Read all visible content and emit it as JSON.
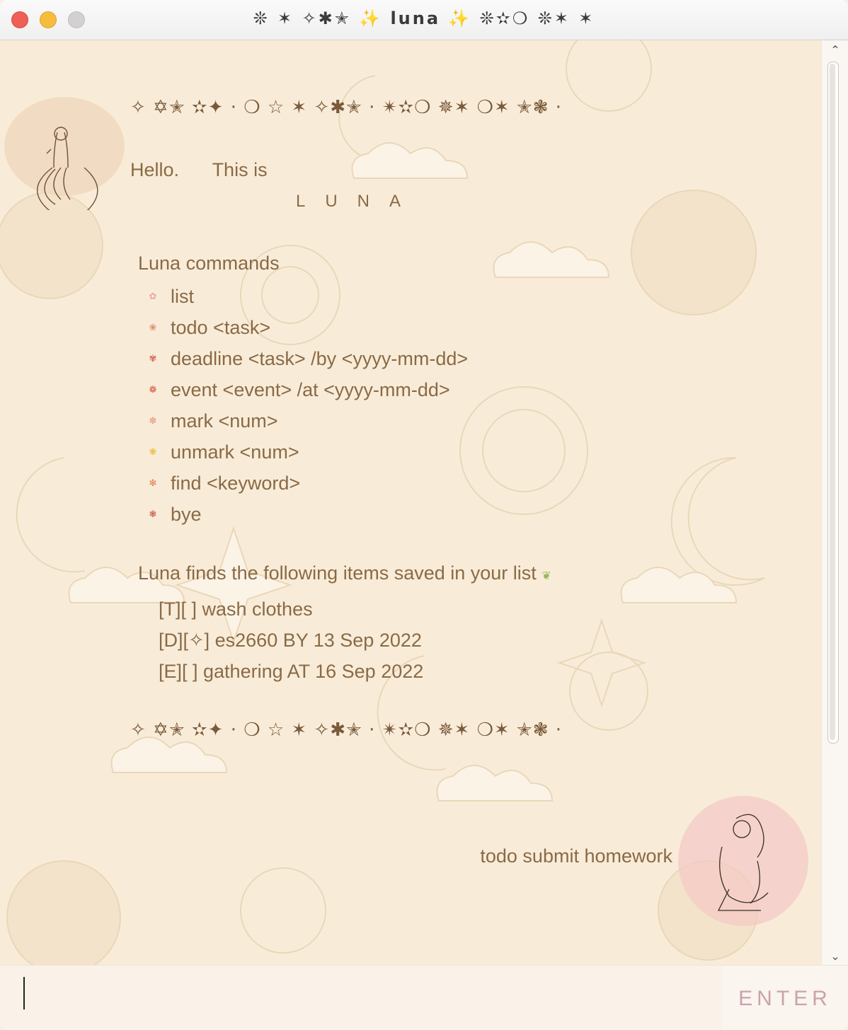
{
  "window": {
    "title": "❊ ✶ ✧✱✭ ✨ luna ✨ ❊✫❍ ❊✶ ✶"
  },
  "chat": {
    "divider_top": "✧ ✡✭ ✫✦ · ❍ ☆ ✶ ✧✱✭ ·  ✴✫❍ ✵✶ ❍✶ ✭❃ ·",
    "hello_a": "Hello.",
    "hello_b": "This is",
    "luna": "LUNA",
    "commands_title": "Luna commands",
    "commands": [
      {
        "label": "list",
        "bullet_color": "#e9a6a6"
      },
      {
        "label": "todo <task>",
        "bullet_color": "#e48a6a"
      },
      {
        "label": "deadline <task> /by <yyyy-mm-dd>",
        "bullet_color": "#d9625a"
      },
      {
        "label": "event <event> /at <yyyy-mm-dd>",
        "bullet_color": "#d9503c"
      },
      {
        "label": "mark <num>",
        "bullet_color": "#e8a88c"
      },
      {
        "label": "unmark <num>",
        "bullet_color": "#e8b830"
      },
      {
        "label": "find <keyword>",
        "bullet_color": "#e07b4a"
      },
      {
        "label": "bye",
        "bullet_color": "#c7614a"
      }
    ],
    "find_title": "Luna finds the following items saved in your list",
    "items": [
      "[T][ ] wash clothes",
      "[D][✧] es2660 BY 13 Sep 2022",
      "[E][ ] gathering AT 16 Sep 2022"
    ],
    "divider_bottom": "✧ ✡✭ ✫✦ · ❍ ☆ ✶ ✧✱✭ ·  ✴✫❍ ✵✶ ❍✶ ✭❃ ·",
    "user_message": "todo submit homework"
  },
  "input": {
    "value": "",
    "placeholder": ""
  },
  "enter_button": {
    "label": "ENTER"
  },
  "colors": {
    "text": "#8a6a45",
    "background": "#f8ecd9",
    "enter": "#c9a3ae"
  }
}
